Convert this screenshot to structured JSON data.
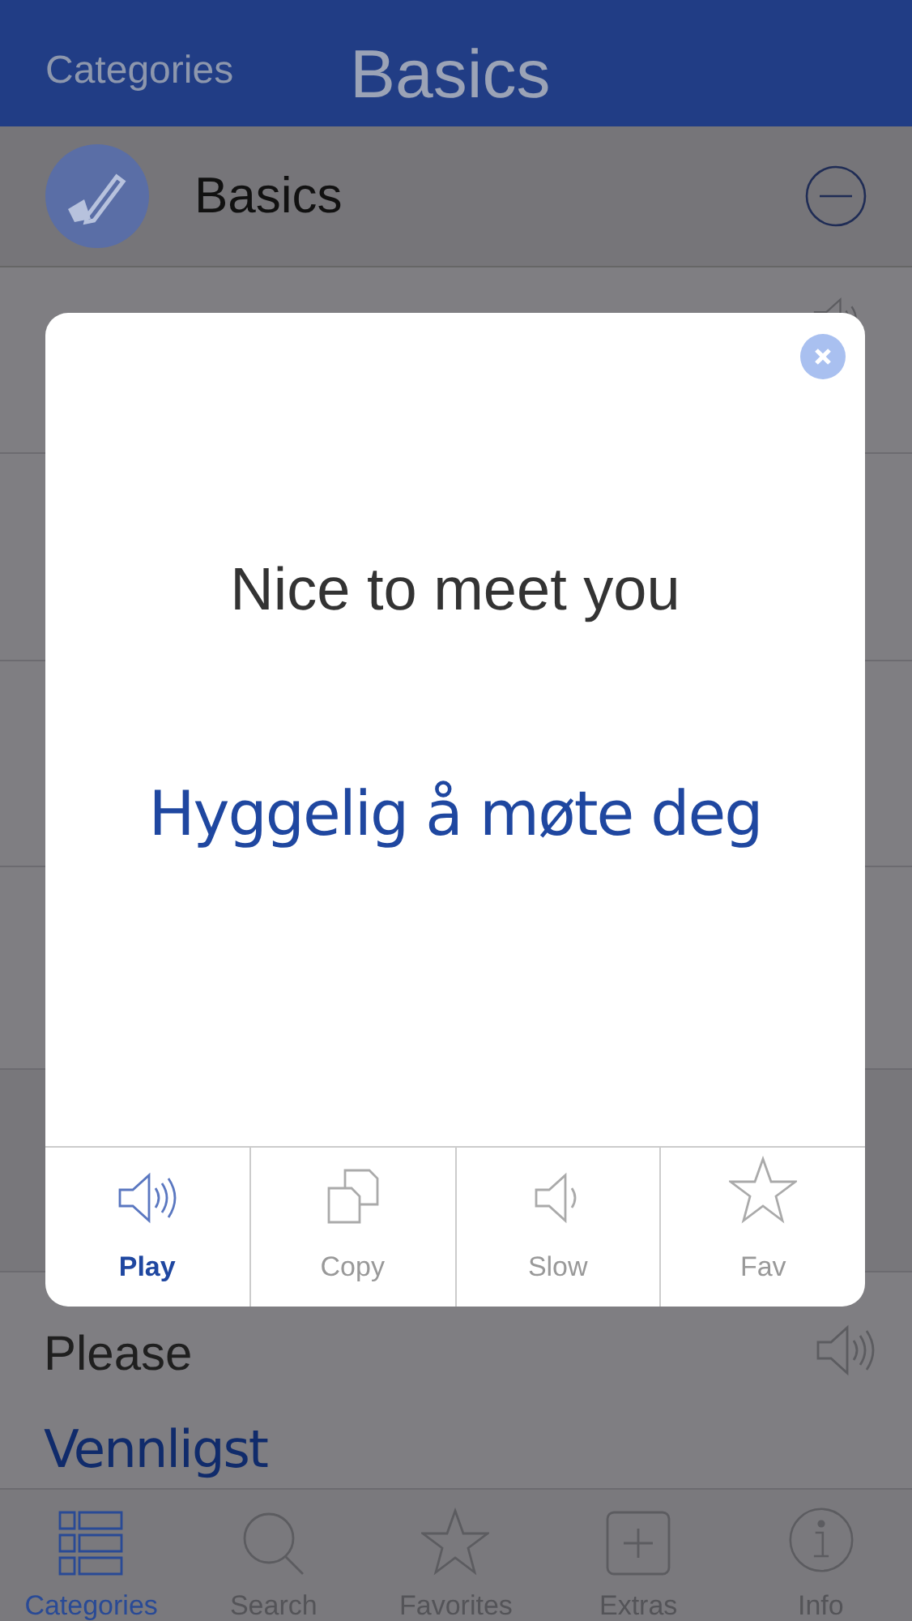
{
  "nav_bar": {
    "back_label": "Categories",
    "title": "Basics"
  },
  "category": {
    "name": "Basics"
  },
  "phrase_rows": [
    {
      "english": "Please",
      "translation": "Vennligst"
    }
  ],
  "popup": {
    "phrase": "Nice to meet you",
    "translation": "Hyggelig å møte deg",
    "actions": [
      {
        "label": "Play",
        "kind": "speaker",
        "selected": true
      },
      {
        "label": "Copy",
        "kind": "copy",
        "selected": false
      },
      {
        "label": "Slow",
        "kind": "slow",
        "selected": false
      },
      {
        "label": "Fav",
        "kind": "star",
        "selected": false
      }
    ]
  },
  "tab_bar": [
    {
      "label": "Categories",
      "kind": "list",
      "selected": true
    },
    {
      "label": "Search",
      "kind": "search",
      "selected": false
    },
    {
      "label": "Favorites",
      "kind": "star",
      "selected": false
    },
    {
      "label": "Extras",
      "kind": "plus",
      "selected": false
    },
    {
      "label": "Info",
      "kind": "info",
      "selected": false
    }
  ]
}
